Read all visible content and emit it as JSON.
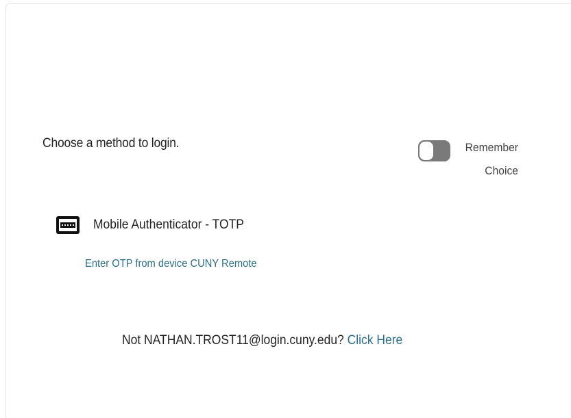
{
  "login": {
    "prompt": "Choose a method to login.",
    "remember": {
      "line1": "Remember",
      "line2": "Choice",
      "enabled": false
    },
    "methods": [
      {
        "name": "Mobile Authenticator - TOTP",
        "description": "Enter OTP from device CUNY Remote",
        "icon": "mobile-device-icon"
      }
    ],
    "not_user": {
      "text": "Not NATHAN.TROST11@login.cuny.edu?",
      "link": "Click Here"
    }
  },
  "colors": {
    "link": "#2c6e8a",
    "toggle_off": "#7a7a7a",
    "text": "#222222"
  }
}
